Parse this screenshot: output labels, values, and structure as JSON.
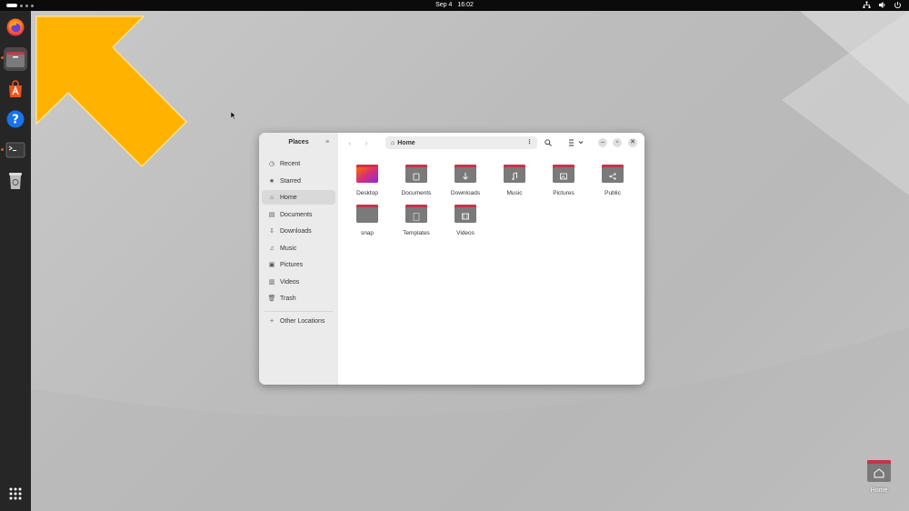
{
  "topbar": {
    "date": "Sep 4",
    "time": "16:02",
    "tray_icons": [
      "network-icon",
      "volume-icon",
      "power-icon"
    ]
  },
  "dock": {
    "items": [
      {
        "name": "firefox",
        "icon": "firefox-icon"
      },
      {
        "name": "files",
        "icon": "files-icon",
        "focused": true,
        "running": true
      },
      {
        "name": "app-center",
        "icon": "app-center-icon"
      },
      {
        "name": "help",
        "icon": "help-icon"
      },
      {
        "name": "terminal",
        "icon": "terminal-icon",
        "running": true
      },
      {
        "name": "trash",
        "icon": "trash-icon"
      }
    ],
    "show_apps_icon": "grid-icon"
  },
  "colors": {
    "accent": "#e95420",
    "arrow_fill": "#ffb300",
    "folder_body": "#7a7a7a",
    "folder_tab": "#c8344a"
  },
  "files_window": {
    "sidebar": {
      "title": "Places",
      "items": [
        {
          "label": "Recent",
          "icon": "clock-icon"
        },
        {
          "label": "Starred",
          "icon": "star-icon"
        },
        {
          "label": "Home",
          "icon": "home-icon",
          "active": true
        },
        {
          "label": "Documents",
          "icon": "document-icon"
        },
        {
          "label": "Downloads",
          "icon": "download-icon"
        },
        {
          "label": "Music",
          "icon": "music-icon"
        },
        {
          "label": "Pictures",
          "icon": "picture-icon"
        },
        {
          "label": "Videos",
          "icon": "video-icon"
        },
        {
          "label": "Trash",
          "icon": "trash-icon"
        }
      ],
      "other_locations": "Other Locations"
    },
    "path": "Home",
    "folders": [
      {
        "label": "Desktop",
        "emblem": ""
      },
      {
        "label": "Documents",
        "emblem": "document"
      },
      {
        "label": "Downloads",
        "emblem": "download"
      },
      {
        "label": "Music",
        "emblem": "music"
      },
      {
        "label": "Pictures",
        "emblem": "picture"
      },
      {
        "label": "Public",
        "emblem": "share"
      },
      {
        "label": "snap",
        "emblem": ""
      },
      {
        "label": "Templates",
        "emblem": "template"
      },
      {
        "label": "Videos",
        "emblem": "video"
      }
    ]
  },
  "desktop_icons": [
    {
      "label": "Home",
      "icon": "home-folder-icon"
    }
  ]
}
